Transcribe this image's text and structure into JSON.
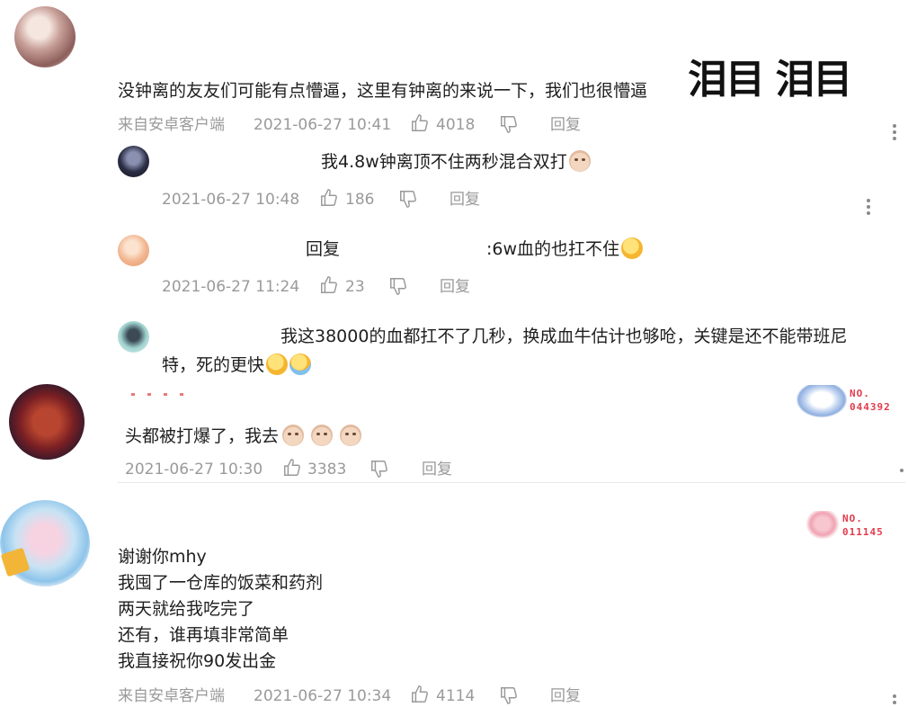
{
  "comment1": {
    "text": "没钟离的友友们可能有点懵逼，这里有钟离的来说一下，我们也很懵逼",
    "sticker_text": "泪目 泪目",
    "source": "来自安卓客户端",
    "time": "2021-06-27 10:41",
    "likes": "4018",
    "reply_label": "回复",
    "replies": [
      {
        "text": "我4.8w钟离顶不住两秒混合双打",
        "time": "2021-06-27 10:48",
        "likes": "186",
        "reply_label": "回复"
      },
      {
        "prefix": "回复",
        "text": ":6w血的也扛不住",
        "time": "2021-06-27 11:24",
        "likes": "23",
        "reply_label": "回复"
      },
      {
        "text_line1": "我这38000的血都扛不了几秒，换成血牛估计也够呛，关键是还不能带班尼",
        "text_line2": "特，死的更快"
      }
    ]
  },
  "comment2": {
    "text": "头都被打爆了，我去",
    "time": "2021-06-27 10:30",
    "likes": "3383",
    "reply_label": "回复",
    "badge_label": "NO.",
    "badge_number": "044392"
  },
  "comment3": {
    "lines": [
      "谢谢你mhy",
      "我囤了一仓库的饭菜和药剂",
      "两天就给我吃完了",
      "还有，谁再填非常简单",
      "我直接祝你90发出金"
    ],
    "source": "来自安卓客户端",
    "time": "2021-06-27 10:34",
    "likes": "4114",
    "reply_label": "回复",
    "badge_label": "NO.",
    "badge_number": "011145"
  },
  "icons": {
    "like": "thumbs-up-icon",
    "dislike": "thumbs-down-icon",
    "more": "more-vertical-icon",
    "emoji_pig": "pig-emoji",
    "emoji_yummy": "yummy-face-emoji",
    "emoji_sad": "crying-face-emoji"
  },
  "colors": {
    "meta_text": "#9a9a9a",
    "badge_red": "#e23b4c"
  }
}
